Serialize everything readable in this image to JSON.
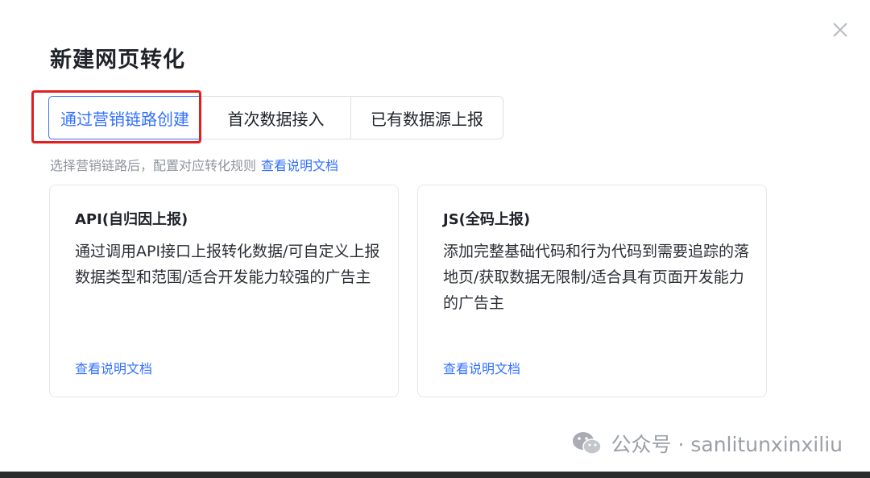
{
  "dialog": {
    "title": "新建网页转化",
    "close_icon": "close-icon"
  },
  "tabs": [
    {
      "label": "通过营销链路创建",
      "selected": true
    },
    {
      "label": "首次数据接入",
      "selected": false
    },
    {
      "label": "已有数据源上报",
      "selected": false
    }
  ],
  "hint": {
    "text": "选择营销链路后，配置对应转化规则",
    "link": "查看说明文档"
  },
  "cards": [
    {
      "title": "API(自归因上报)",
      "description": "通过调用API接口上报转化数据/可自定义上报数据类型和范围/适合开发能力较强的广告主",
      "link": "查看说明文档"
    },
    {
      "title": "JS(全码上报)",
      "description": "添加完整基础代码和行为代码到需要追踪的落地页/获取数据无限制/适合具有页面开发能力的广告主",
      "link": "查看说明文档"
    }
  ],
  "watermark": {
    "text": "公众号 · sanlitunxinxiliu",
    "icon": "wechat-icon"
  },
  "colors": {
    "accent": "#3370ff",
    "highlight": "#e02020",
    "muted_text": "#8f959e"
  }
}
